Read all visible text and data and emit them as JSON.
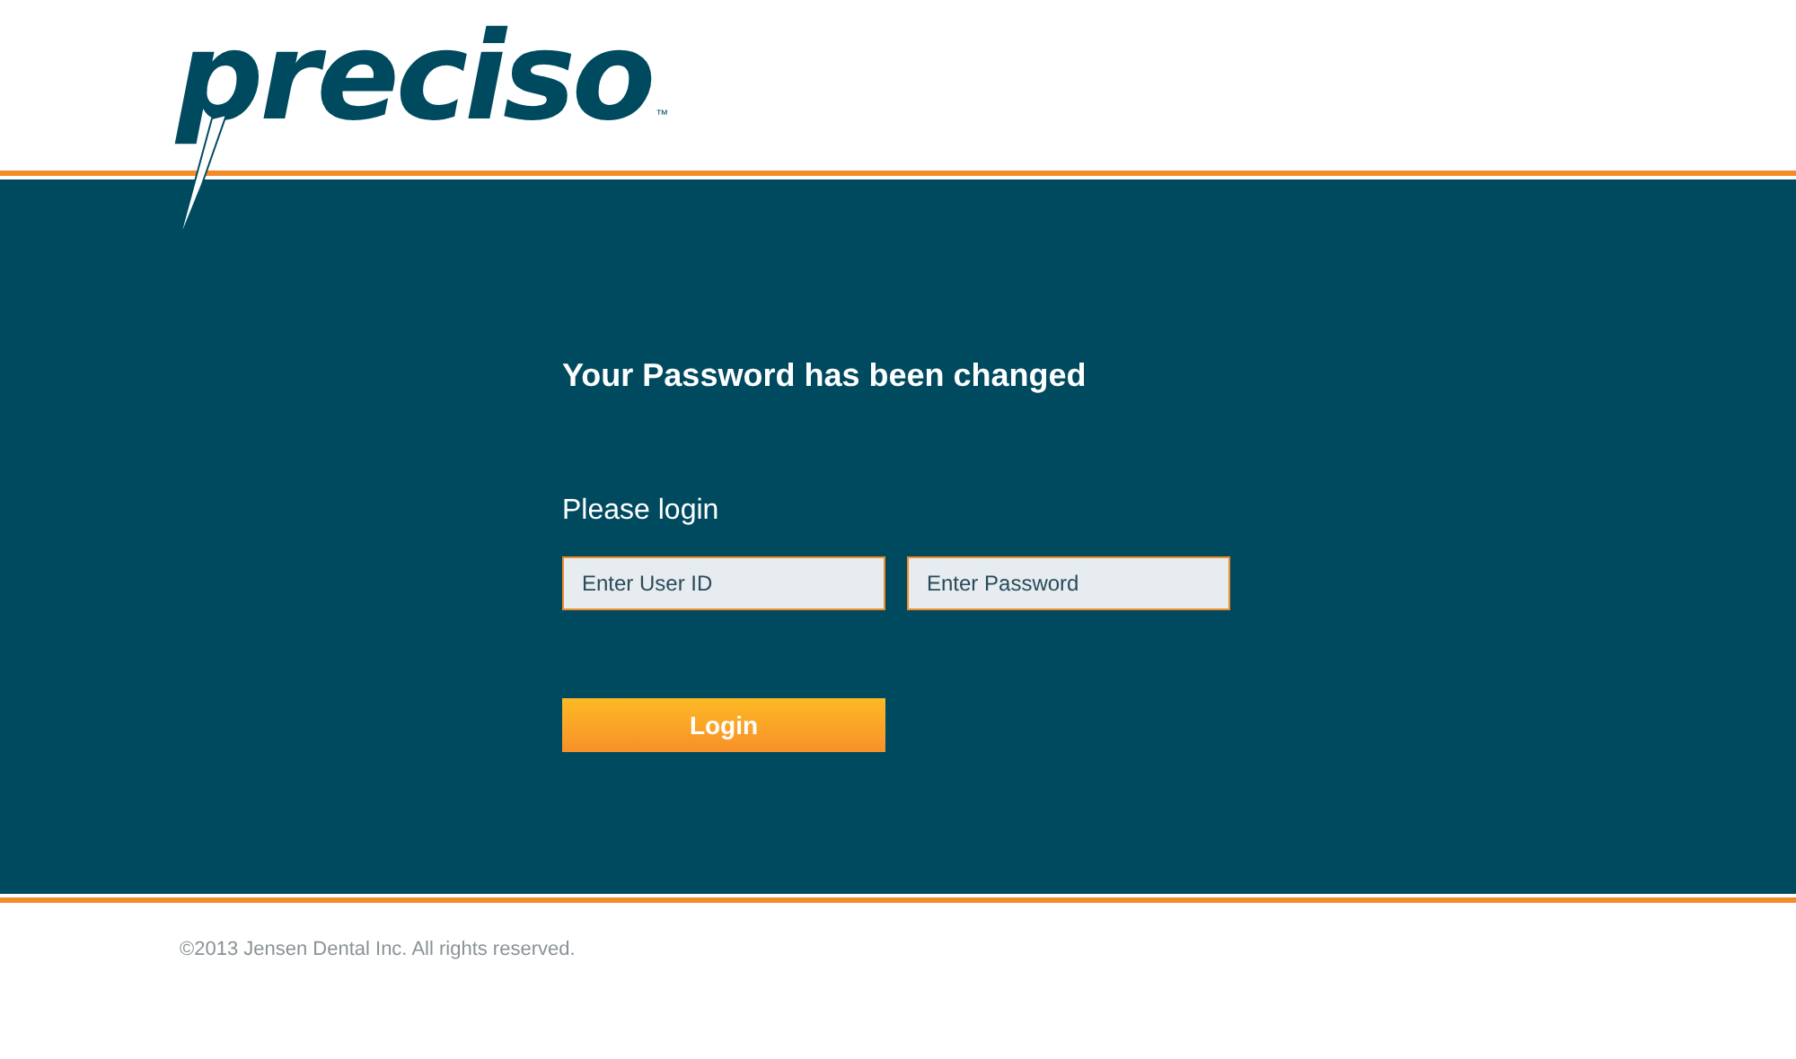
{
  "logo": {
    "text": "preciso",
    "trademark": "™"
  },
  "message": "Your Password has been changed",
  "login": {
    "prompt": "Please login",
    "user_field": {
      "placeholder": "Enter User ID"
    },
    "password_field": {
      "placeholder": "Enter Password"
    },
    "button": "Login"
  },
  "footer": "©2013 Jensen Dental Inc. All rights reserved."
}
